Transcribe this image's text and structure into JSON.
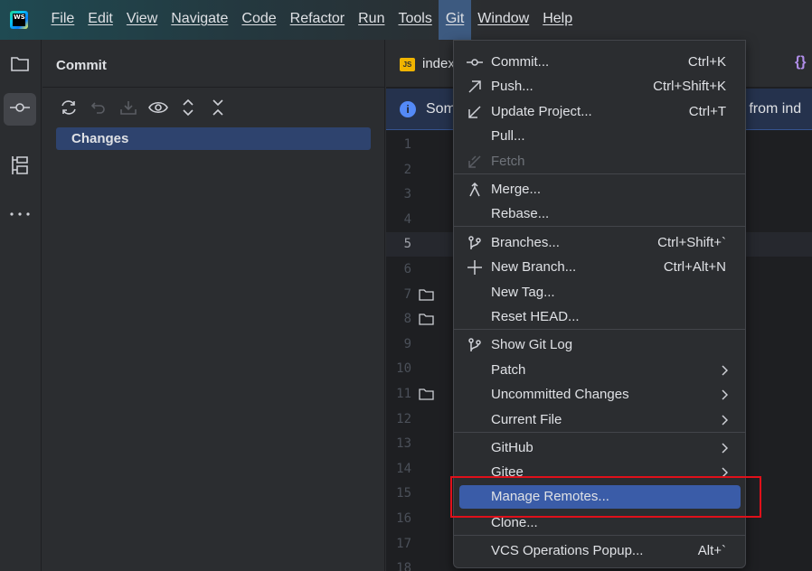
{
  "app": {
    "logo_text": "WS",
    "icon": "webstorm-logo"
  },
  "menubar": {
    "items": [
      {
        "label": "File"
      },
      {
        "label": "Edit"
      },
      {
        "label": "View"
      },
      {
        "label": "Navigate"
      },
      {
        "label": "Code"
      },
      {
        "label": "Refactor"
      },
      {
        "label": "Run"
      },
      {
        "label": "Tools"
      },
      {
        "label": "Git"
      },
      {
        "label": "Window"
      },
      {
        "label": "Help"
      }
    ],
    "active": "Git"
  },
  "toolstrip": {
    "items": [
      {
        "name": "project",
        "icon": "folder-icon"
      },
      {
        "name": "commit",
        "icon": "commit-icon",
        "active": true
      },
      {
        "name": "structure",
        "icon": "structure-icon"
      },
      {
        "name": "more",
        "icon": "more-icon"
      }
    ]
  },
  "commit_panel": {
    "title": "Commit",
    "toolbar": [
      "refresh-icon",
      "rollback-icon",
      "shelve-icon",
      "preview-icon",
      "expand-all-icon",
      "collapse-all-icon"
    ],
    "changes_label": "Changes"
  },
  "editor": {
    "tab": {
      "label": "index",
      "icon_text": "JS",
      "right_icon": "{}"
    },
    "banner": {
      "left": "Som",
      "right": "d from ind"
    },
    "line_numbers": [
      "1",
      "2",
      "3",
      "4",
      "5",
      "6",
      "7",
      "8",
      "9",
      "10",
      "11",
      "12",
      "13",
      "14",
      "15",
      "16",
      "17",
      "18"
    ],
    "current_line": "5",
    "fold_lines": [
      "7",
      "8",
      "11"
    ]
  },
  "git_menu": {
    "items": [
      {
        "label": "Commit...",
        "shortcut": "Ctrl+K",
        "icon": "commit-icon"
      },
      {
        "label": "Push...",
        "shortcut": "Ctrl+Shift+K",
        "icon": "push-arrow-icon"
      },
      {
        "label": "Update Project...",
        "shortcut": "Ctrl+T",
        "icon": "update-arrow-icon"
      },
      {
        "label": "Pull...",
        "shortcut": "",
        "icon": ""
      },
      {
        "label": "Fetch",
        "shortcut": "",
        "icon": "fetch-icon",
        "disabled": true
      },
      {
        "label": "Merge...",
        "shortcut": "",
        "icon": "merge-icon"
      },
      {
        "label": "Rebase...",
        "shortcut": "",
        "icon": ""
      },
      {
        "label": "Branches...",
        "shortcut": "Ctrl+Shift+`",
        "icon": "branch-icon"
      },
      {
        "label": "New Branch...",
        "shortcut": "Ctrl+Alt+N",
        "icon": "plus-icon"
      },
      {
        "label": "New Tag...",
        "shortcut": "",
        "icon": ""
      },
      {
        "label": "Reset HEAD...",
        "shortcut": "",
        "icon": ""
      },
      {
        "label": "Show Git Log",
        "shortcut": "",
        "icon": "branch-icon"
      },
      {
        "label": "Patch",
        "submenu": true
      },
      {
        "label": "Uncommitted Changes",
        "submenu": true
      },
      {
        "label": "Current File",
        "submenu": true
      },
      {
        "label": "GitHub",
        "submenu": true
      },
      {
        "label": "Gitee",
        "submenu": true
      },
      {
        "label": "Manage Remotes...",
        "selected": true
      },
      {
        "label": "Clone..."
      },
      {
        "label": "VCS Operations Popup...",
        "shortcut": "Alt+`"
      }
    ]
  },
  "colors": {
    "accent_selection": "#3a5ca8",
    "highlight_box": "#e0101a",
    "banner_bg": "#25324d"
  }
}
